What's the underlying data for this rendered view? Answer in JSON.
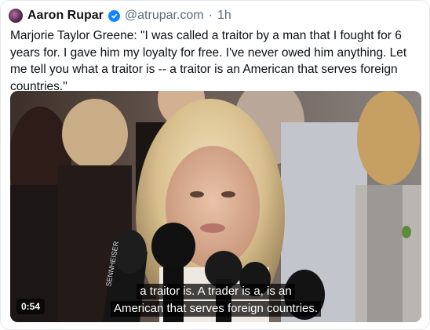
{
  "post": {
    "author_name": "Aaron Rupar",
    "handle": "@atrupar.com",
    "separator": "·",
    "time": "1h",
    "text": "Marjorie Taylor Greene: \"I was called a traitor by a man that I fought for 6 years for. I gave him my loyalty for free. I've never owed him anything. Let me tell you what a traitor is -- a traitor is an American that serves foreign countries.\""
  },
  "video": {
    "duration": "0:54",
    "caption_line_1": "a traitor is. A trader is a, is an",
    "caption_line_2": "American that serves foreign countries.",
    "mic_brand": "SENNHEISER"
  },
  "icons": {
    "verified": "verified-check-icon",
    "verified_color": "#1185fe"
  }
}
